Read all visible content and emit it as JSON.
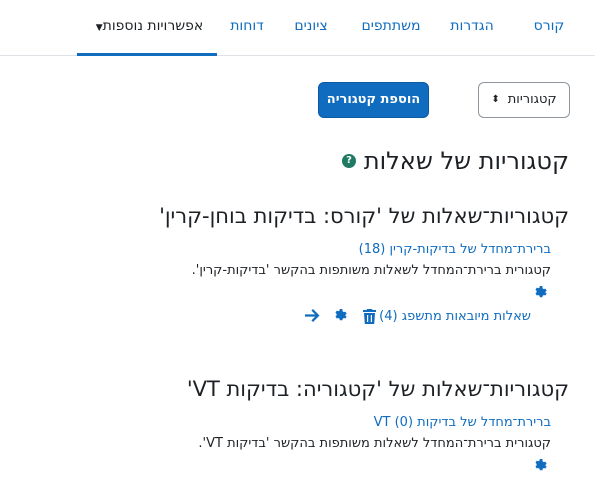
{
  "nav": {
    "tabs": [
      {
        "label": "קורס",
        "active": false
      },
      {
        "label": "הגדרות",
        "active": false
      },
      {
        "label": "משתתפים",
        "active": false
      },
      {
        "label": "ציונים",
        "active": false
      },
      {
        "label": "דוחות",
        "active": false
      },
      {
        "label": "אפשרויות נוספות",
        "active": true,
        "dropdown": true
      }
    ]
  },
  "toolbar": {
    "categories_button": "קטגוריות",
    "add_category_button": "הוספת קטגוריה"
  },
  "page": {
    "title": "קטגוריות של שאלות"
  },
  "sections": [
    {
      "heading": "קטגוריות־שאלות של 'קורס: בדיקות בוחן-קרין'",
      "default_link": "ברירת־מחדל של בדיקות-קרין (18)",
      "description": "קטגורית ברירת־המחדל לשאלות משותפות בהקשר 'בדיקות-קרין'.",
      "imported_link": "שאלות מיובאות מתשפג (4)"
    },
    {
      "heading": "קטגוריות־שאלות של 'קטגוריה: בדיקות VT'",
      "default_link": "ברירת־מחדל של בדיקות (0) VT",
      "description": "קטגורית ברירת־המחדל לשאלות משותפות בהקשר 'בדיקות VT'."
    }
  ],
  "colors": {
    "primary": "#0f6cbf",
    "text": "#1d2125",
    "help": "#1f7a64"
  }
}
